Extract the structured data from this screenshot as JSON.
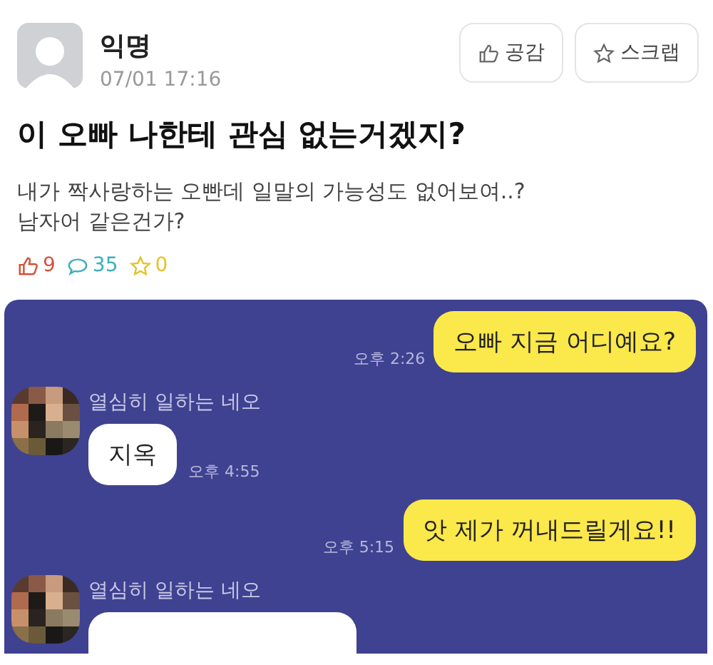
{
  "post": {
    "author": "익명",
    "date": "07/01 17:16",
    "buttons": [
      {
        "label": "공감",
        "kind": "like"
      },
      {
        "label": "스크랩",
        "kind": "scrap"
      }
    ],
    "title": "이 오빠 나한테 관심 없는거겠지?",
    "body": [
      "내가 짝사랑하는 오빤데 일말의 가능성도 없어보여..?",
      "남자어 같은건가?"
    ],
    "stats": [
      {
        "kind": "like",
        "count": "9",
        "color": "#d0523a"
      },
      {
        "kind": "comment",
        "count": "35",
        "color": "#3ab0b8"
      },
      {
        "kind": "scrap",
        "count": "0",
        "color": "#e6c229"
      }
    ]
  },
  "chat": {
    "messages": [
      {
        "kind": "sent",
        "text": "오빠 지금 어디예요?",
        "time": "오후 2:26"
      },
      {
        "kind": "received",
        "sender": "열심히 일하는 네오",
        "text": "지옥",
        "time": "오후 4:55"
      },
      {
        "kind": "sent",
        "text": "앗 제가 꺼내드릴게요!!",
        "time": "오후 5:15"
      },
      {
        "kind": "received",
        "sender": "열심히 일하는 네오"
      }
    ]
  }
}
